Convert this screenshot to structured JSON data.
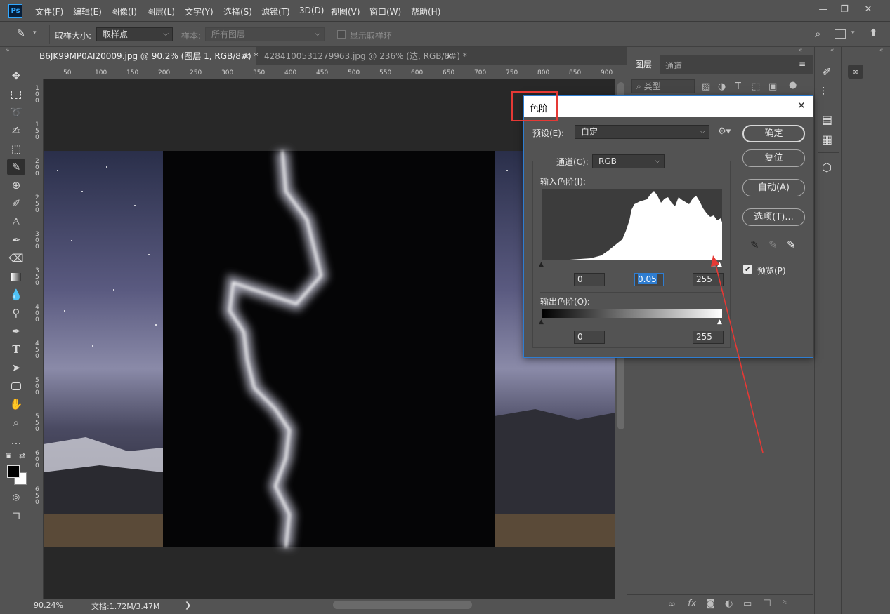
{
  "app": {
    "logo": "Ps"
  },
  "menu": [
    "文件(F)",
    "编辑(E)",
    "图像(I)",
    "图层(L)",
    "文字(Y)",
    "选择(S)",
    "滤镜(T)",
    "3D(D)",
    "视图(V)",
    "窗口(W)",
    "帮助(H)"
  ],
  "window_controls": {
    "minimize": "—",
    "restore": "❐",
    "close": "✕"
  },
  "options": {
    "sample_size_label": "取样大小:",
    "sample_size_value": "取样点",
    "sample_label": "样本:",
    "sample_value": "所有图层",
    "show_ring_label": "显示取样环"
  },
  "tabs": [
    {
      "label": "B6JK99MP0AI20009.jpg @ 90.2% (图层 1, RGB/8#) *",
      "close": "×"
    },
    {
      "label": "4284100531279963.jpg @ 236% (达, RGB/8#) *",
      "close": "×"
    }
  ],
  "ruler_top": [
    "50",
    "100",
    "150",
    "200",
    "250",
    "300",
    "350",
    "400",
    "450",
    "500",
    "550",
    "600",
    "650",
    "700",
    "750",
    "800",
    "850",
    "900"
  ],
  "ruler_left": [
    "1",
    "0",
    "0",
    "1",
    "5",
    "0",
    "2",
    "0",
    "0",
    "2",
    "5",
    "0",
    "3",
    "0",
    "0",
    "3",
    "5",
    "0",
    "4",
    "0",
    "0",
    "4",
    "5",
    "0",
    "5",
    "0",
    "0",
    "5",
    "5",
    "0",
    "6",
    "0",
    "0",
    "6",
    "5",
    "0"
  ],
  "status": {
    "zoom": "90.24%",
    "doc": "文档:1.72M/3.47M",
    "arrow": "❯"
  },
  "panels": {
    "tab_layers": "图层",
    "tab_channels": "通道",
    "filter_kind": "类型"
  },
  "dialog": {
    "title": "色阶",
    "preset_label": "预设(E):",
    "preset_value": "自定",
    "channel_label": "通道(C):",
    "channel_value": "RGB",
    "input_levels_label": "输入色阶(I):",
    "output_levels_label": "输出色阶(O):",
    "input_black": "0",
    "input_gamma": "0.05",
    "input_white": "255",
    "output_black": "0",
    "output_white": "255",
    "ok": "确定",
    "reset": "复位",
    "auto": "自动(A)",
    "options": "选项(T)...",
    "preview_label": "预览(P)",
    "preview_checked": true,
    "close": "✕"
  },
  "colors": {
    "accent": "#2e7dd1",
    "highlight": "#e53935",
    "annotation": "#e53935"
  }
}
